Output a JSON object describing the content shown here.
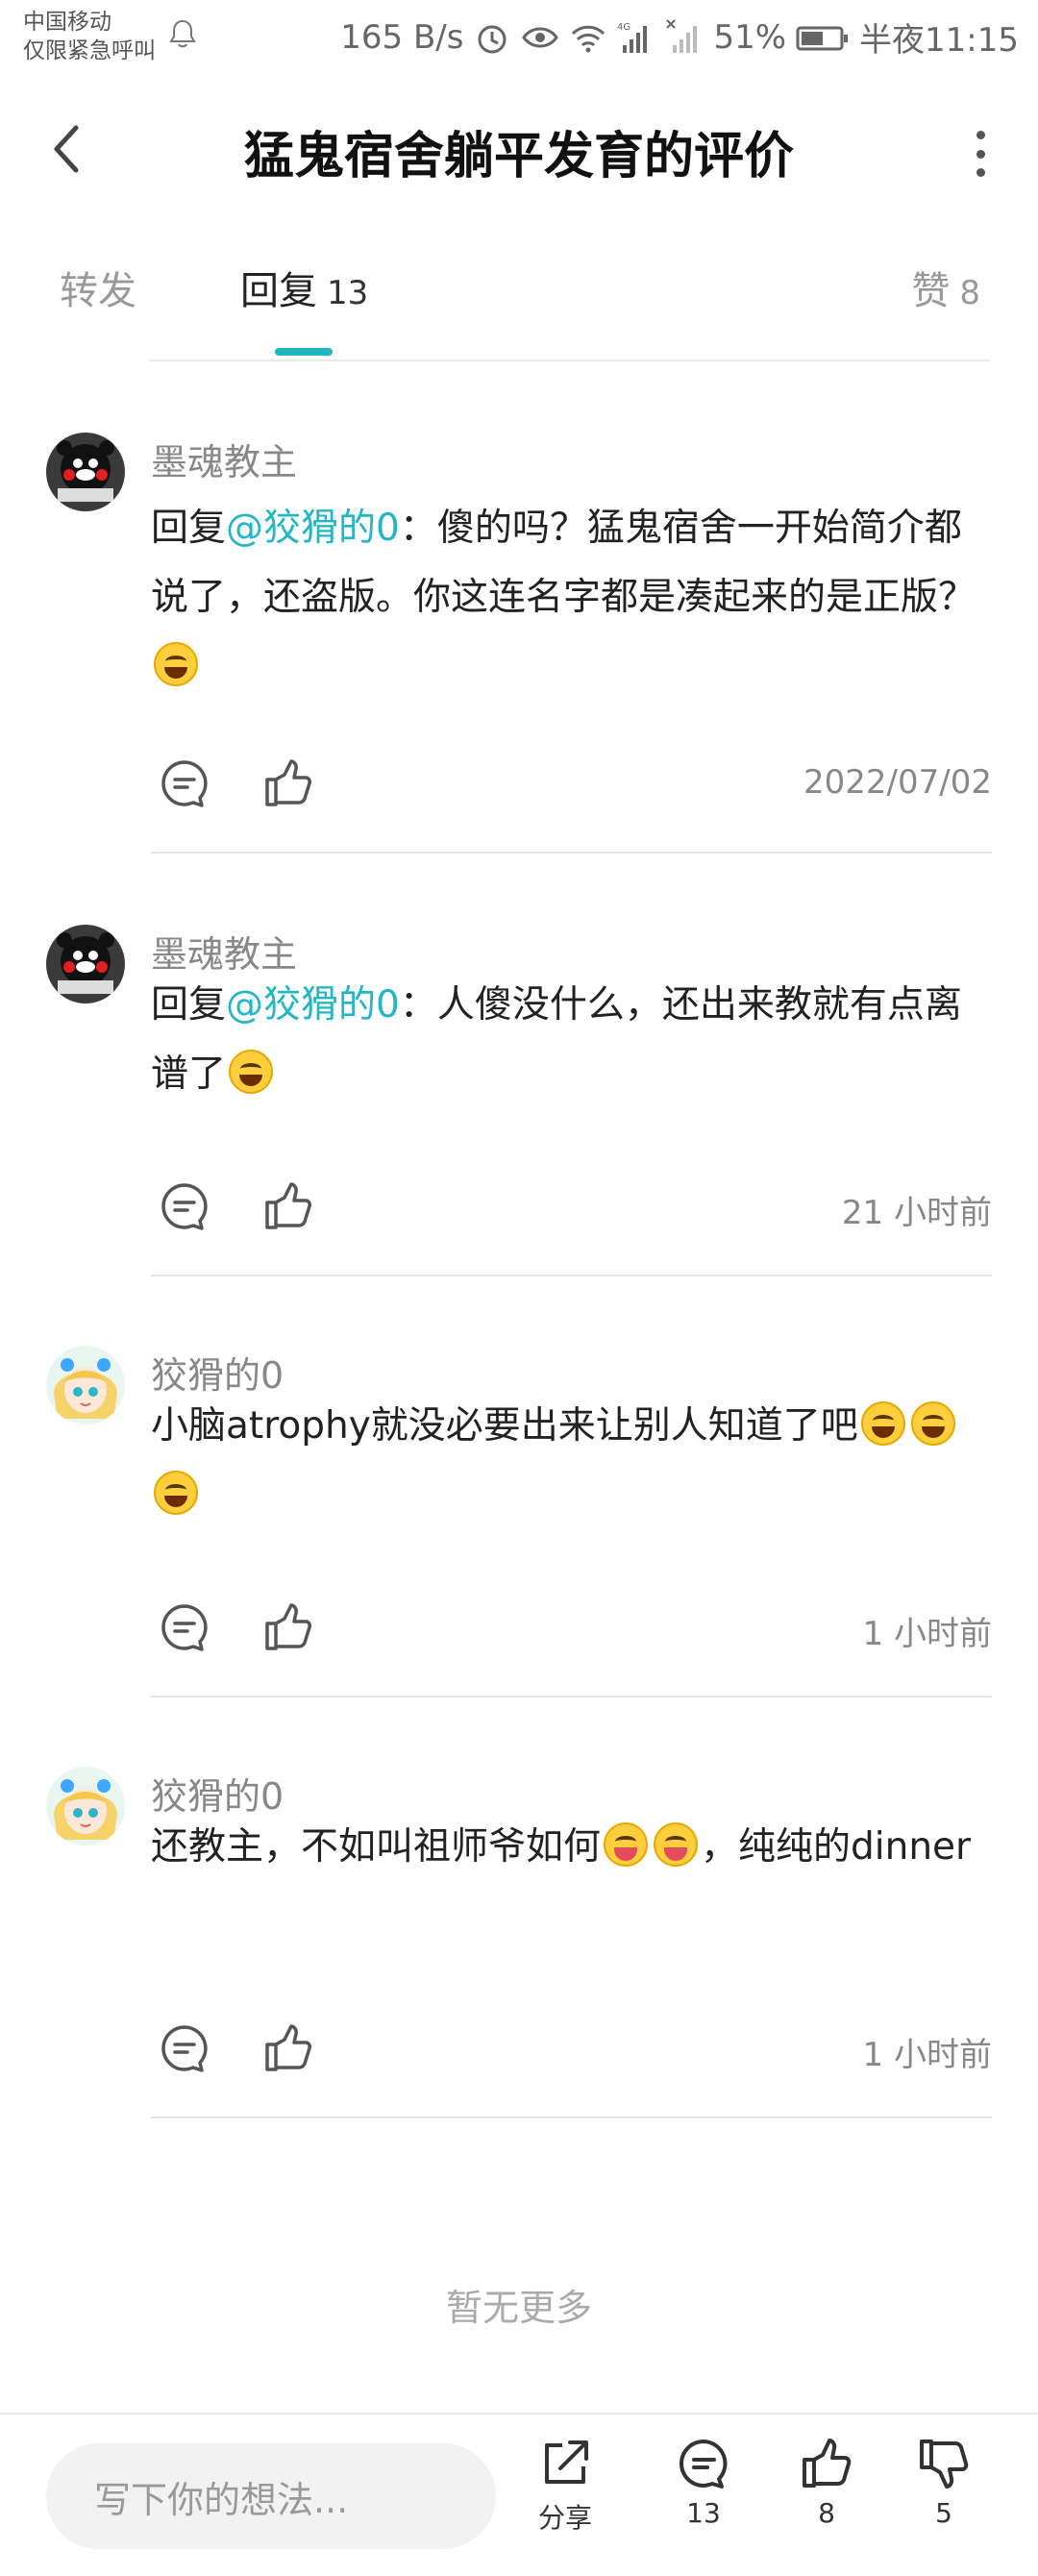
{
  "status_bar": {
    "carrier_line1": "中国移动",
    "carrier_line2": "仅限紧急呼叫",
    "speed": "165 B/s",
    "battery": "51%",
    "time": "半夜11:15"
  },
  "header": {
    "title": "猛鬼宿舍躺平发育的评价"
  },
  "tabs": {
    "repost": {
      "label": "转发"
    },
    "reply": {
      "label": "回复",
      "count": "13"
    },
    "like": {
      "label": "赞",
      "count": "8"
    }
  },
  "comments": [
    {
      "username": "墨魂教主",
      "reply_prefix": "回复",
      "mention": "@狡猾的0",
      "text": "：傻的吗？猛鬼宿舍一开始简介都说了，还盗版。你这连名字都是凑起来的是正版？",
      "timestamp": "2022/07/02"
    },
    {
      "username": "墨魂教主",
      "reply_prefix": "回复",
      "mention": "@狡猾的0",
      "text": "：人傻没什么，还出来教就有点离谱了",
      "timestamp": "21 小时前"
    },
    {
      "username": "狡猾的0",
      "text": "小脑atrophy就没必要出来让别人知道了吧",
      "timestamp": "1 小时前"
    },
    {
      "username": "狡猾的0",
      "text_before": "还教主，不如叫祖师爷如何",
      "text_after": "，纯纯的dinner",
      "timestamp": "1 小时前"
    }
  ],
  "no_more": "暂无更多",
  "bottom_bar": {
    "input_placeholder": "写下你的想法...",
    "share_label": "分享",
    "comment_count": "13",
    "like_count": "8",
    "dislike_count": "5"
  },
  "colors": {
    "accent": "#1fb6c1",
    "mention": "#23b7c6"
  }
}
